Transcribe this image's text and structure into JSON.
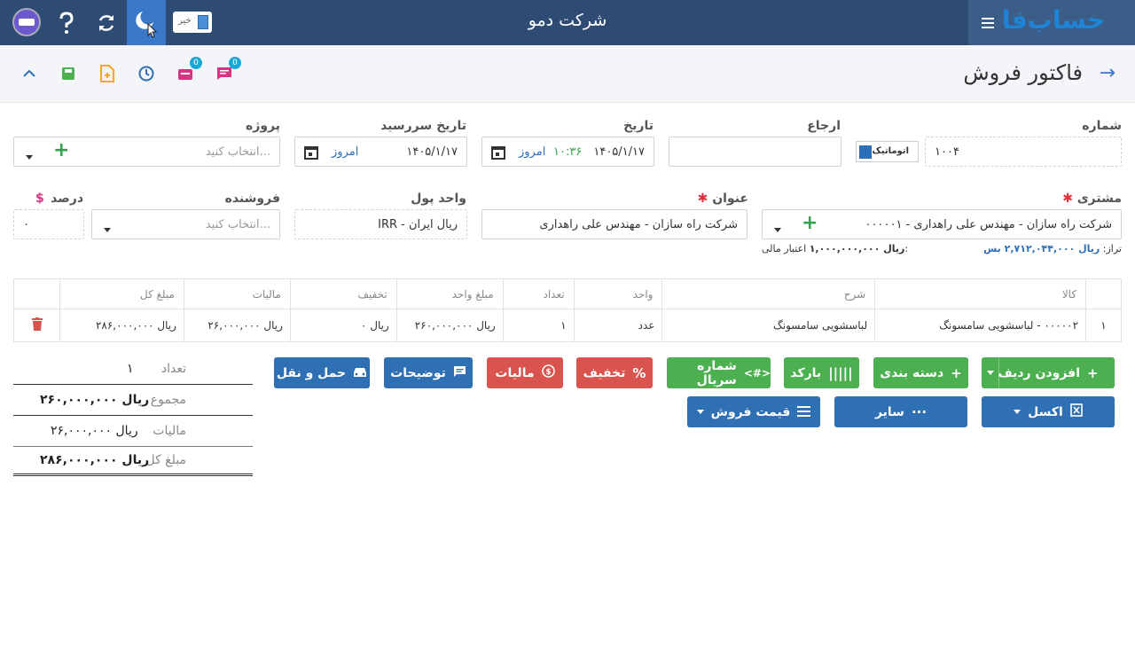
{
  "header": {
    "company": "شرکت دمو",
    "logo": "حساب‌فا",
    "toggle_label": "خیر"
  },
  "subheader": {
    "page_title": "فاکتور فروش",
    "badge1": "0",
    "badge2": "0"
  },
  "form": {
    "number_label": "شماره",
    "number_value": "۱۰۰۴",
    "auto_label": "اتوماتیک",
    "reference_label": "ارجاع",
    "reference_value": "",
    "date_label": "تاریخ",
    "date_value": "۱۴۰۵/۱/۱۷",
    "date_time": "۱۰:۳۶",
    "date_today": "امروز",
    "due_label": "تاریخ سررسید",
    "due_value": "۱۴۰۵/۱/۱۷",
    "due_today": "امروز",
    "project_label": "پروژه",
    "project_placeholder": "انتخاب کنید...",
    "customer_label": "مشتری",
    "customer_value": "۰۰۰۰۰۱ - شرکت راه سازان - مهندس علی راهداری",
    "title_label": "عنوان",
    "title_value": "شرکت راه سازان - مهندس علی راهداری",
    "currency_label": "واحد پول",
    "currency_value": "IRR - ریال ایران",
    "seller_label": "فروشنده",
    "seller_placeholder": "انتخاب کنید...",
    "percent_label": "درصد",
    "percent_symbol": "$",
    "percent_value": "۰",
    "balance_label": "تراز:",
    "balance_value": "ریال ۲,۷۱۲,۰۴۴,۰۰۰ بس",
    "credit_label": "اعتبار مالی:",
    "credit_value": "ریال ۱,۰۰۰,۰۰۰,۰۰۰"
  },
  "table": {
    "headers": [
      "کالا",
      "شرح",
      "واحد",
      "تعداد",
      "مبلغ واحد",
      "تخفیف",
      "مالیات",
      "مبلغ کل"
    ],
    "rows": [
      {
        "index": "۱",
        "item": "۰۰۰۰۰۲ - لباسشویی سامسونگ",
        "desc": "لباسشویی سامسونگ",
        "unit": "عدد",
        "qty": "۱",
        "unit_price": "ریال ۲۶۰,۰۰۰,۰۰۰",
        "discount": "ریال ۰",
        "tax": "ریال ۲۶,۰۰۰,۰۰۰",
        "total": "ریال ۲۸۶,۰۰۰,۰۰۰"
      }
    ]
  },
  "buttons": {
    "add_row": "افزودن ردیف",
    "category": "دسته بندی",
    "barcode": "بارکد",
    "serial": "شماره سریال",
    "discount": "تخفیف",
    "tax": "مالیات",
    "notes": "توضیحات",
    "shipping": "حمل و نقل",
    "excel": "اکسل",
    "other": "سایر",
    "sale_price": "قیمت فروش"
  },
  "totals": {
    "count_label": "تعداد",
    "count_value": "۱",
    "sum_label": "مجموع",
    "sum_value": "ریال ۲۶۰,۰۰۰,۰۰۰",
    "tax_label": "مالیات",
    "tax_value": "ریال ۲۶,۰۰۰,۰۰۰",
    "total_label": "مبلغ کل",
    "total_value": "ریال ۲۸۶,۰۰۰,۰۰۰"
  },
  "colors": {
    "topbar": "#2d4b73",
    "accent_blue": "#2f6fb4",
    "green": "#4caf50",
    "red": "#d9534f"
  }
}
